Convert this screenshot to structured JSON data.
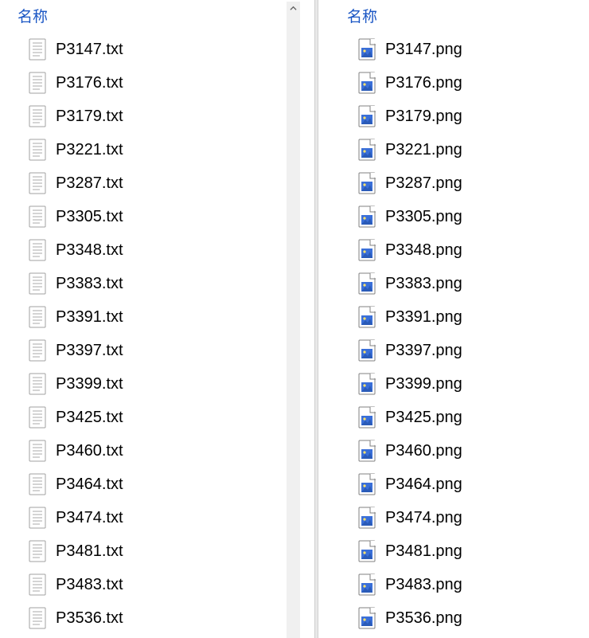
{
  "left": {
    "header": "名称",
    "files": [
      {
        "name": "P3147.txt"
      },
      {
        "name": "P3176.txt"
      },
      {
        "name": "P3179.txt"
      },
      {
        "name": "P3221.txt"
      },
      {
        "name": "P3287.txt"
      },
      {
        "name": "P3305.txt"
      },
      {
        "name": "P3348.txt"
      },
      {
        "name": "P3383.txt"
      },
      {
        "name": "P3391.txt"
      },
      {
        "name": "P3397.txt"
      },
      {
        "name": "P3399.txt"
      },
      {
        "name": "P3425.txt"
      },
      {
        "name": "P3460.txt"
      },
      {
        "name": "P3464.txt"
      },
      {
        "name": "P3474.txt"
      },
      {
        "name": "P3481.txt"
      },
      {
        "name": "P3483.txt"
      },
      {
        "name": "P3536.txt"
      }
    ]
  },
  "right": {
    "header": "名称",
    "files": [
      {
        "name": "P3147.png"
      },
      {
        "name": "P3176.png"
      },
      {
        "name": "P3179.png"
      },
      {
        "name": "P3221.png"
      },
      {
        "name": "P3287.png"
      },
      {
        "name": "P3305.png"
      },
      {
        "name": "P3348.png"
      },
      {
        "name": "P3383.png"
      },
      {
        "name": "P3391.png"
      },
      {
        "name": "P3397.png"
      },
      {
        "name": "P3399.png"
      },
      {
        "name": "P3425.png"
      },
      {
        "name": "P3460.png"
      },
      {
        "name": "P3464.png"
      },
      {
        "name": "P3474.png"
      },
      {
        "name": "P3481.png"
      },
      {
        "name": "P3483.png"
      },
      {
        "name": "P3536.png"
      }
    ]
  }
}
